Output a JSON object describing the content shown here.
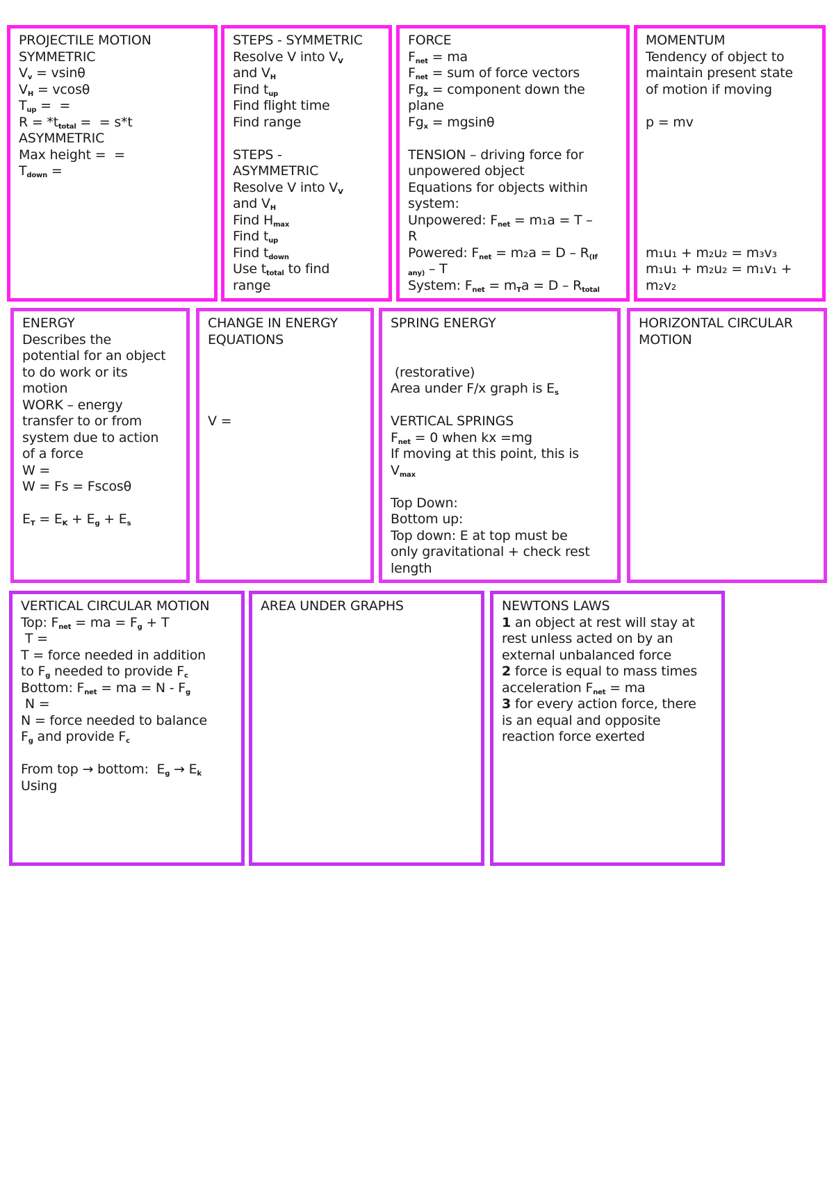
{
  "colors": {
    "row1_border": "#ff22ee",
    "row2_border": "#e23af0",
    "row3_border": "#c133f2"
  },
  "cards": [
    {
      "id": "projectile-motion",
      "lines": [
        "PROJECTILE MOTION",
        "SYMMETRIC",
        "V{v} = vsinθ",
        "V{H} = vcosθ",
        "T{up} =  =",
        "R = *t{total} =  = s*t",
        "ASYMMETRIC",
        "Max height =  =",
        "T{down} ="
      ]
    },
    {
      "id": "steps",
      "lines": [
        "STEPS - SYMMETRIC",
        "Resolve V into V{V}",
        "and V{H}",
        "Find t{up}",
        "Find flight time",
        "Find range",
        "",
        "STEPS -",
        "ASYMMETRIC",
        "Resolve V into V{V}",
        "and V{H}",
        "Find H{max}",
        "Find t{up}",
        "Find t{down}",
        "Use t{total} to find",
        "range"
      ]
    },
    {
      "id": "force",
      "lines": [
        "FORCE",
        "F{net} = ma",
        "F{net} = sum of force vectors",
        "Fg{x} = component down the",
        "plane",
        "Fg{x} = mgsinθ",
        "",
        "TENSION – driving force for",
        "unpowered object",
        "Equations for objects within",
        "system:",
        "Unpowered: F{net} = m₁a = T –",
        "R",
        "Powered: F{net} = m₂a = D – R{(If}",
        "{any)} – T",
        "System: F{net} = m{T}a = D – R{total}"
      ]
    },
    {
      "id": "momentum",
      "lines": [
        "MOMENTUM",
        "Tendency of object to",
        "maintain present state",
        "of motion if moving",
        "",
        "p = mv",
        "",
        "",
        "",
        "",
        "",
        "",
        "",
        "m₁u₁ + m₂u₂ = m₃v₃",
        "m₁u₁ + m₂u₂ = m₁v₁ +",
        "m₂v₂"
      ]
    },
    {
      "id": "energy",
      "lines": [
        "ENERGY",
        "Describes the",
        "potential for an object",
        "to do work or its",
        "motion",
        "WORK – energy",
        "transfer to or from",
        "system due to action",
        "of a force",
        "W =",
        "W = Fs = Fscosθ",
        "",
        "E{T} = E{K} + E{g} + E{s}"
      ]
    },
    {
      "id": "change-in-energy",
      "lines": [
        "CHANGE IN ENERGY",
        "EQUATIONS",
        "",
        "",
        "",
        "",
        "V ="
      ]
    },
    {
      "id": "spring-energy",
      "lines": [
        "SPRING ENERGY",
        "",
        "",
        " (restorative)",
        "Area under F/x graph is E{s}",
        "",
        "VERTICAL SPRINGS",
        "F{net} = 0 when kx =mg",
        "If moving at this point, this is",
        "V{max}",
        "",
        "Top Down:",
        "Bottom up:",
        "Top down: E at top must be",
        "only gravitational + check rest",
        "length"
      ]
    },
    {
      "id": "horizontal-circular-motion",
      "lines": [
        "HORIZONTAL CIRCULAR",
        "MOTION"
      ]
    },
    {
      "id": "vertical-circular-motion",
      "lines": [
        "VERTICAL CIRCULAR MOTION",
        "Top: F{net} = ma = F{g} + T",
        " T =",
        "T = force needed in addition",
        "to F{g} needed to provide F{c}",
        "Bottom: F{net} = ma = N - F{g}",
        " N =",
        "N = force needed to balance",
        "F{g} and provide F{c}",
        "",
        "From top → bottom:  E{g} → E{k}",
        "Using"
      ]
    },
    {
      "id": "area-under-graphs",
      "lines": [
        "AREA UNDER GRAPHS"
      ]
    },
    {
      "id": "newtons-laws",
      "lines": [
        "NEWTONS LAWS",
        "[1] an object at rest will stay at",
        "rest unless acted on by an",
        "external unbalanced force",
        "[2] force is equal to mass times",
        "acceleration F{net} = ma",
        "[3] for every action force, there",
        "is an equal and opposite",
        "reaction force exerted"
      ]
    }
  ]
}
